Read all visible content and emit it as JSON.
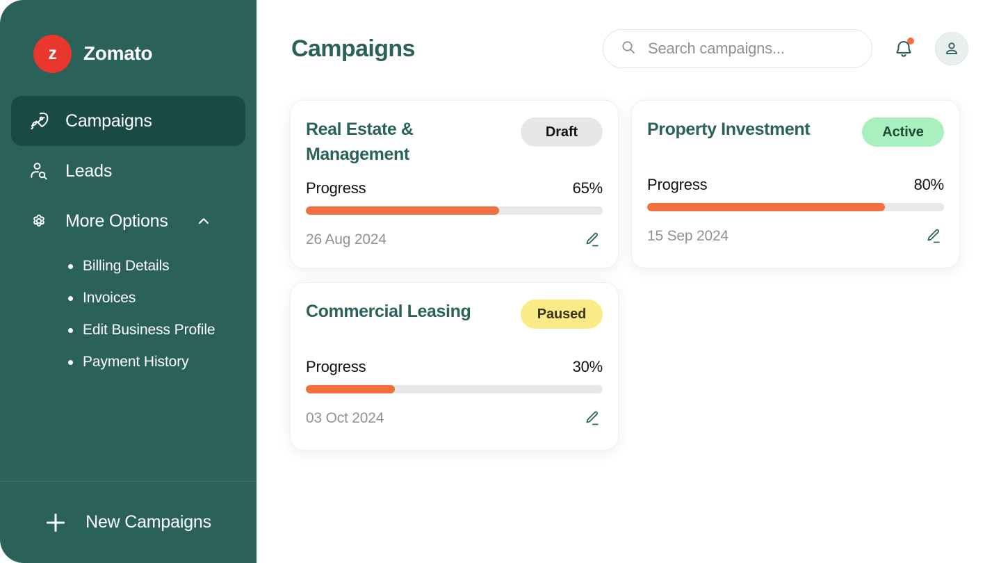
{
  "brand": {
    "logo_letter": "z",
    "name": "Zomato",
    "logo_color": "#e8372c"
  },
  "sidebar": {
    "items": [
      {
        "label": "Campaigns",
        "icon": "rocket-icon",
        "active": true
      },
      {
        "label": "Leads",
        "icon": "user-search-icon",
        "active": false
      },
      {
        "label": "More Options",
        "icon": "gear-icon",
        "active": false,
        "expanded": true,
        "chevron": "chevron-up-icon"
      }
    ],
    "sub_items": [
      {
        "label": "Billing Details"
      },
      {
        "label": "Invoices"
      },
      {
        "label": "Edit Business Profile"
      },
      {
        "label": "Payment History"
      }
    ],
    "footer": {
      "label": "New Campaigns",
      "icon": "plus-icon"
    },
    "background_color": "#2a6159",
    "active_item_color": "#194a43"
  },
  "header": {
    "title": "Campaigns",
    "title_color": "#2a6159",
    "search": {
      "placeholder": "Search campaigns...",
      "value": "",
      "icon": "search-icon"
    },
    "notifications": {
      "icon": "bell-icon",
      "has_unread": true,
      "dot_color": "#f2703f"
    },
    "account": {
      "icon": "user-avatar-icon"
    }
  },
  "campaigns": [
    {
      "title": "Real Estate & Management",
      "status": "Draft",
      "status_type": "draft",
      "progress_label": "Progress",
      "progress_value": "65%",
      "progress_pct": 65,
      "date": "26 Aug 2024",
      "edit_icon": "pencil-icon"
    },
    {
      "title": "Property Investment",
      "status": "Active",
      "status_type": "active",
      "progress_label": "Progress",
      "progress_value": "80%",
      "progress_pct": 80,
      "date": "15 Sep 2024",
      "edit_icon": "pencil-icon"
    },
    {
      "title": "Commercial Leasing",
      "status": "Paused",
      "status_type": "paused",
      "progress_label": "Progress",
      "progress_value": "30%",
      "progress_pct": 30,
      "date": "03 Oct 2024",
      "edit_icon": "pencil-icon"
    }
  ],
  "colors": {
    "accent_orange": "#f2703f",
    "brand_green": "#2a6159",
    "track_gray": "#e7e8ea",
    "badge_draft_bg": "#e6e7e9",
    "badge_active_bg": "#a8f0c0",
    "badge_paused_bg": "#fbeb87"
  }
}
